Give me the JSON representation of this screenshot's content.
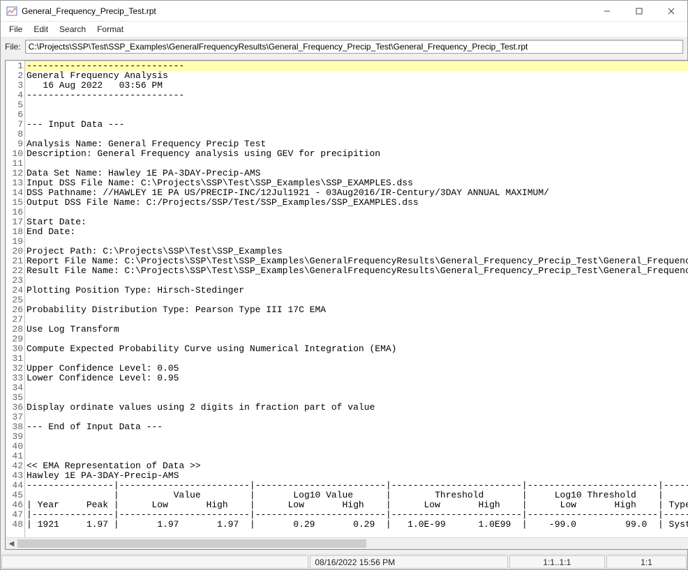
{
  "window": {
    "title": "General_Frequency_Precip_Test.rpt"
  },
  "menu": {
    "file": "File",
    "edit": "Edit",
    "search": "Search",
    "format": "Format"
  },
  "file_field": {
    "label": "File:",
    "value": "C:\\Projects\\SSP\\Test\\SSP_Examples\\GeneralFrequencyResults\\General_Frequency_Precip_Test\\General_Frequency_Precip_Test.rpt"
  },
  "lines": [
    "-----------------------------",
    "General Frequency Analysis",
    "   16 Aug 2022   03:56 PM",
    "-----------------------------",
    "",
    "",
    "--- Input Data ---",
    "",
    "Analysis Name: General Frequency Precip Test",
    "Description: General Frequency analysis using GEV for precipition",
    "",
    "Data Set Name: Hawley 1E PA-3DAY-Precip-AMS",
    "Input DSS File Name: C:\\Projects\\SSP\\Test\\SSP_Examples\\SSP_EXAMPLES.dss",
    "DSS Pathname: //HAWLEY 1E PA US/PRECIP-INC/12Jul1921 - 03Aug2016/IR-Century/3DAY ANNUAL MAXIMUM/",
    "Output DSS File Name: C:/Projects/SSP/Test/SSP_Examples/SSP_EXAMPLES.dss",
    "",
    "Start Date:",
    "End Date:",
    "",
    "Project Path: C:\\Projects\\SSP\\Test\\SSP_Examples",
    "Report File Name: C:\\Projects\\SSP\\Test\\SSP_Examples\\GeneralFrequencyResults\\General_Frequency_Precip_Test\\General_Frequency_Precip_",
    "Result File Name: C:\\Projects\\SSP\\Test\\SSP_Examples\\GeneralFrequencyResults\\General_Frequency_Precip_Test\\General_Frequency_Precip_",
    "",
    "Plotting Position Type: Hirsch-Stedinger",
    "",
    "Probability Distribution Type: Pearson Type III 17C EMA",
    "",
    "Use Log Transform",
    "",
    "Compute Expected Probability Curve using Numerical Integration (EMA)",
    "",
    "Upper Confidence Level: 0.05",
    "Lower Confidence Level: 0.95",
    "",
    "",
    "Display ordinate values using 2 digits in fraction part of value",
    "",
    "--- End of Input Data ---",
    "",
    "",
    "",
    "<< EMA Representation of Data >>",
    "Hawley 1E PA-3DAY-Precip-AMS",
    "----------------|------------------------|------------------------|------------------------|------------------------|-----",
    "                |          Value         |       Log10 Value      |        Threshold       |     Log10 Threshold    |",
    "| Year     Peak |      Low       High    |      Low       High    |      Low       High    |      Low       High    | Type",
    "|---------------|------------------------|------------------------|------------------------|------------------------|-----",
    "| 1921     1.97 |       1.97       1.97  |       0.29       0.29  |   1.0E-99      1.0E99  |    -99.0         99.0  | Syst"
  ],
  "status": {
    "datetime": "08/16/2022 15:56 PM",
    "pos": "1:1..1:1",
    "ratio": "1:1"
  }
}
